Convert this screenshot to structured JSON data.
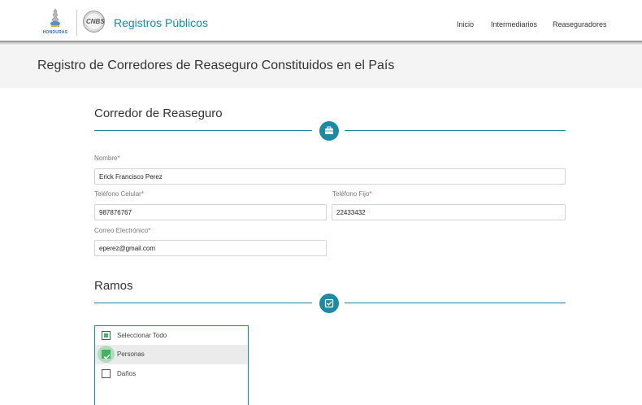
{
  "header": {
    "logo_country_text": "HONDURAS",
    "logo_cnbs_text": "CNBS",
    "app_title": "Registros Públicos",
    "nav": [
      {
        "label": "Inicio"
      },
      {
        "label": "Intermediarios"
      },
      {
        "label": "Reaseguradores"
      }
    ]
  },
  "page": {
    "title": "Registro de Corredores de Reaseguro Constituidos en el País"
  },
  "corredor": {
    "section_title": "Corredor de Reaseguro",
    "section_icon": "briefcase-icon",
    "required_mark": "*",
    "nombre": {
      "label": "Nombre",
      "value": "Erick Francisco Perez"
    },
    "telefono_celular": {
      "label": "Teléfono Celular",
      "value": "987876767"
    },
    "telefono_fijo": {
      "label": "Teléfono Fijo",
      "value": "22433432"
    },
    "correo": {
      "label": "Correo Electrónico",
      "value": "eperez@gmail.com"
    }
  },
  "ramos": {
    "section_title": "Ramos",
    "section_icon": "check-square-icon",
    "items": [
      {
        "label": "Seleccionar Todo",
        "state": "partial"
      },
      {
        "label": "Personas",
        "state": "checked"
      },
      {
        "label": "Daños",
        "state": "unchecked"
      }
    ]
  },
  "colors": {
    "accent": "#1c8aa4",
    "check_green": "#3fb55f",
    "required_red": "#d9534f"
  }
}
